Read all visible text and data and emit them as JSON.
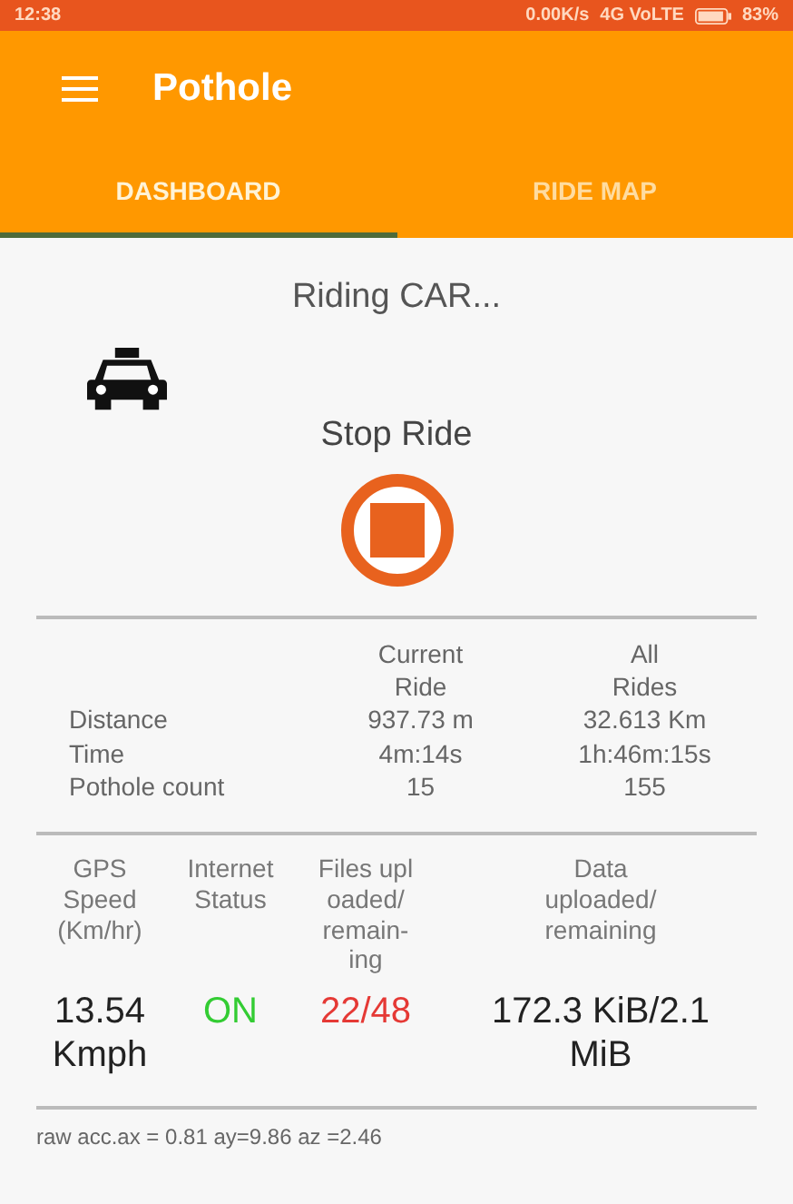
{
  "status_bar": {
    "time": "12:38",
    "speed": "0.00K/s",
    "network": "4G VoLTE",
    "battery": "83%"
  },
  "toolbar": {
    "title": "Pothole"
  },
  "tabs": [
    {
      "label": "DASHBOARD",
      "selected": true
    },
    {
      "label": "RIDE MAP",
      "selected": false
    }
  ],
  "ride": {
    "status": "Riding CAR...",
    "action": "Stop Ride"
  },
  "stats": {
    "columns": [
      "Current\nRide",
      "All\nRides"
    ],
    "rows": [
      {
        "label": "Distance",
        "current": "937.73 m",
        "all": "32.613 Km"
      },
      {
        "label": "Time",
        "current": "4m:14s",
        "all": "1h:46m:15s"
      },
      {
        "label": "Pothole count",
        "current": "15",
        "all": "155"
      }
    ]
  },
  "metrics": [
    {
      "heading": "GPS\nSpeed\n(Km/hr)",
      "value": "13.54\nKmph",
      "color": "#222222"
    },
    {
      "heading": "Internet\nStatus",
      "value": "ON",
      "color": "#33cc33"
    },
    {
      "heading": "Files upl\noaded/\nremain-\ning",
      "value": "22/48",
      "color": "#e53935"
    },
    {
      "heading": "Data\nuploaded/\nremaining",
      "value": "172.3 KiB/2.1\nMiB",
      "color": "#222222"
    }
  ],
  "raw_acc": "raw acc.ax = 0.81 ay=9.86 az =2.46"
}
